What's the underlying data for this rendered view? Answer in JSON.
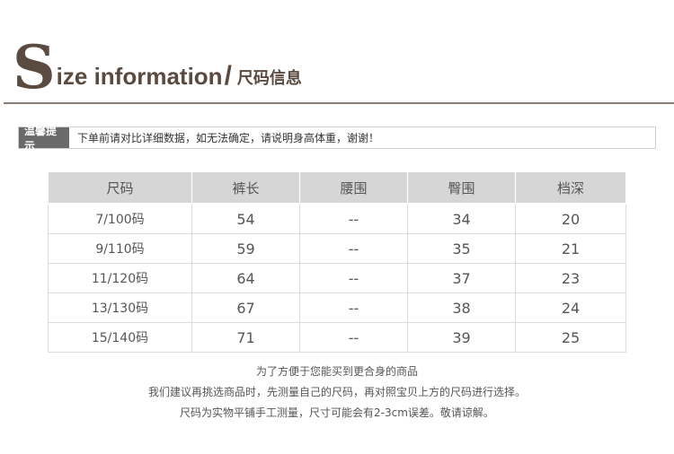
{
  "header": {
    "big_letter": "S",
    "title_rest": "ize information",
    "slash": "/",
    "title_cn": "尺码信息"
  },
  "tip": {
    "label": "温馨提示",
    "text": "下单前请对比详细数据，如无法确定，请说明身高体重，谢谢！"
  },
  "table": {
    "headers": [
      "尺码",
      "裤长",
      "腰围",
      "臀围",
      "档深"
    ],
    "rows": [
      [
        "7/100码",
        "54",
        "--",
        "34",
        "20"
      ],
      [
        "9/110码",
        "59",
        "--",
        "35",
        "21"
      ],
      [
        "11/120码",
        "64",
        "--",
        "37",
        "23"
      ],
      [
        "13/130码",
        "67",
        "--",
        "38",
        "24"
      ],
      [
        "15/140码",
        "71",
        "--",
        "39",
        "25"
      ]
    ]
  },
  "notes": [
    "为了方便于您能买到更合身的商品",
    "我们建议再挑选商品时，先测量自己的尺码，再对照宝贝上方的尺码进行选择。",
    "尺码为实物平铺手工测量，尺寸可能会有2-3cm误差。敬请谅解。"
  ]
}
